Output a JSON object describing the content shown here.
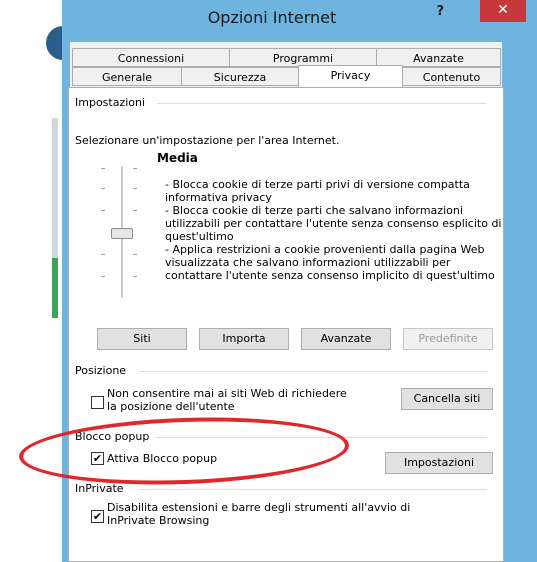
{
  "dialog": {
    "title": "Opzioni Internet",
    "help_label": "?",
    "close_label": "✕"
  },
  "tabs_back": [
    "Connessioni",
    "Programmi",
    "Avanzate"
  ],
  "tabs_front": [
    "Generale",
    "Sicurezza",
    "Privacy",
    "Contenuto"
  ],
  "selected_tab": "Privacy",
  "settings": {
    "group_label": "Impostazioni",
    "instruction": "Selezionare un'impostazione per l'area Internet.",
    "level_label": "Media",
    "description_lines": [
      "- Blocca cookie di terze parti privi di versione compatta",
      "informativa privacy",
      "- Blocca cookie di terze parti che salvano informazioni",
      "utilizzabili per contattare l'utente senza consenso esplicito di",
      "quest'ultimo",
      "- Applica restrizioni a cookie provenienti dalla pagina Web",
      "visualizzata che salvano informazioni utilizzabili per",
      "contattare l'utente senza consenso implicito di quest'ultimo"
    ],
    "buttons": {
      "sites": "Siti",
      "import": "Importa",
      "advanced": "Avanzate",
      "default": "Predefinite"
    }
  },
  "position": {
    "group_label": "Posizione",
    "checkbox_line1": "Non consentire mai ai siti Web di richiedere",
    "checkbox_line2": "la posizione dell'utente",
    "checked": false,
    "clear_button": "Cancella siti"
  },
  "popup": {
    "group_label": "Blocco popup",
    "checkbox_label": "Attiva Blocco popup",
    "checked": true,
    "settings_button": "Impostazioni"
  },
  "inprivate": {
    "group_label": "InPrivate",
    "checkbox_line1": "Disabilita estensioni e barre degli strumenti all'avvio di",
    "checkbox_line2": "InPrivate Browsing",
    "checked": true
  },
  "colors": {
    "frame": "#6fb4df",
    "close": "#c7383a",
    "highlight_ellipse": "#e0282a"
  }
}
